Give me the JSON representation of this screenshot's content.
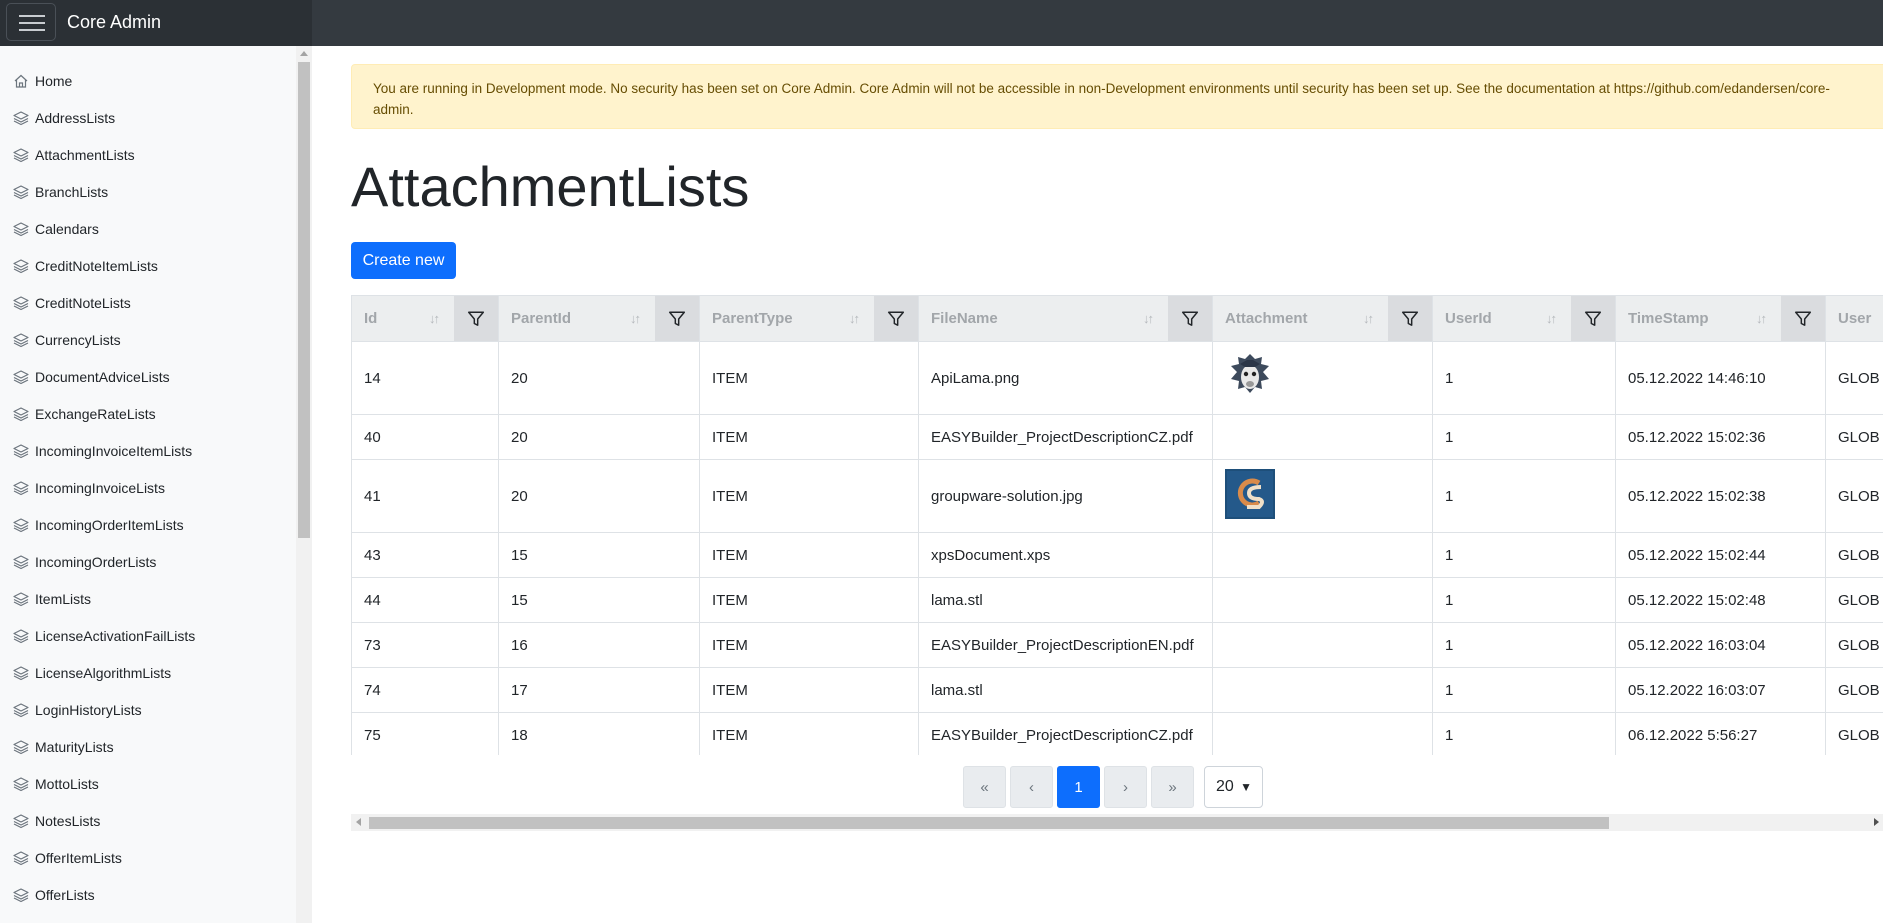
{
  "app": {
    "brand": "Core Admin"
  },
  "sidebar": {
    "items": [
      {
        "label": "Home",
        "icon": "home-icon"
      },
      {
        "label": "AddressLists",
        "icon": "layers-icon"
      },
      {
        "label": "AttachmentLists",
        "icon": "layers-icon"
      },
      {
        "label": "BranchLists",
        "icon": "layers-icon"
      },
      {
        "label": "Calendars",
        "icon": "layers-icon"
      },
      {
        "label": "CreditNoteItemLists",
        "icon": "layers-icon"
      },
      {
        "label": "CreditNoteLists",
        "icon": "layers-icon"
      },
      {
        "label": "CurrencyLists",
        "icon": "layers-icon"
      },
      {
        "label": "DocumentAdviceLists",
        "icon": "layers-icon"
      },
      {
        "label": "ExchangeRateLists",
        "icon": "layers-icon"
      },
      {
        "label": "IncomingInvoiceItemLists",
        "icon": "layers-icon"
      },
      {
        "label": "IncomingInvoiceLists",
        "icon": "layers-icon"
      },
      {
        "label": "IncomingOrderItemLists",
        "icon": "layers-icon"
      },
      {
        "label": "IncomingOrderLists",
        "icon": "layers-icon"
      },
      {
        "label": "ItemLists",
        "icon": "layers-icon"
      },
      {
        "label": "LicenseActivationFailLists",
        "icon": "layers-icon"
      },
      {
        "label": "LicenseAlgorithmLists",
        "icon": "layers-icon"
      },
      {
        "label": "LoginHistoryLists",
        "icon": "layers-icon"
      },
      {
        "label": "MaturityLists",
        "icon": "layers-icon"
      },
      {
        "label": "MottoLists",
        "icon": "layers-icon"
      },
      {
        "label": "NotesLists",
        "icon": "layers-icon"
      },
      {
        "label": "OfferItemLists",
        "icon": "layers-icon"
      },
      {
        "label": "OfferLists",
        "icon": "layers-icon"
      }
    ]
  },
  "alert": {
    "text": "You are running in Development mode. No security has been set on Core Admin. Core Admin will not be accessible in non-Development environments until security has been set up. See the documentation at https://github.com/edandersen/core-admin."
  },
  "page": {
    "title": "AttachmentLists",
    "create_label": "Create new"
  },
  "table": {
    "columns": [
      "Id",
      "ParentId",
      "ParentType",
      "FileName",
      "Attachment",
      "UserId",
      "TimeStamp",
      "User"
    ],
    "rows": [
      {
        "id": "14",
        "parent_id": "20",
        "parent_type": "ITEM",
        "file_name": "ApiLama.png",
        "attachment": "lama-image",
        "user_id": "1",
        "timestamp": "05.12.2022 14:46:10",
        "user": "GLOB"
      },
      {
        "id": "40",
        "parent_id": "20",
        "parent_type": "ITEM",
        "file_name": "EASYBuilder_ProjectDescriptionCZ.pdf",
        "attachment": "",
        "user_id": "1",
        "timestamp": "05.12.2022 15:02:36",
        "user": "GLOB"
      },
      {
        "id": "41",
        "parent_id": "20",
        "parent_type": "ITEM",
        "file_name": "groupware-solution.jpg",
        "attachment": "gs-logo-image",
        "user_id": "1",
        "timestamp": "05.12.2022 15:02:38",
        "user": "GLOB"
      },
      {
        "id": "43",
        "parent_id": "15",
        "parent_type": "ITEM",
        "file_name": "xpsDocument.xps",
        "attachment": "",
        "user_id": "1",
        "timestamp": "05.12.2022 15:02:44",
        "user": "GLOB"
      },
      {
        "id": "44",
        "parent_id": "15",
        "parent_type": "ITEM",
        "file_name": "lama.stl",
        "attachment": "",
        "user_id": "1",
        "timestamp": "05.12.2022 15:02:48",
        "user": "GLOB"
      },
      {
        "id": "73",
        "parent_id": "16",
        "parent_type": "ITEM",
        "file_name": "EASYBuilder_ProjectDescriptionEN.pdf",
        "attachment": "",
        "user_id": "1",
        "timestamp": "05.12.2022 16:03:04",
        "user": "GLOB"
      },
      {
        "id": "74",
        "parent_id": "17",
        "parent_type": "ITEM",
        "file_name": "lama.stl",
        "attachment": "",
        "user_id": "1",
        "timestamp": "05.12.2022 16:03:07",
        "user": "GLOB"
      },
      {
        "id": "75",
        "parent_id": "18",
        "parent_type": "ITEM",
        "file_name": "EASYBuilder_ProjectDescriptionCZ.pdf",
        "attachment": "",
        "user_id": "1",
        "timestamp": "06.12.2022 5:56:27",
        "user": "GLOB"
      }
    ]
  },
  "pagination": {
    "first": "«",
    "prev": "‹",
    "current": "1",
    "next": "›",
    "last": "»",
    "page_size": "20"
  },
  "colors": {
    "primary": "#0d6efd",
    "topbar": "#343a40",
    "alert_bg": "#fff3cd",
    "alert_text": "#664d03"
  }
}
